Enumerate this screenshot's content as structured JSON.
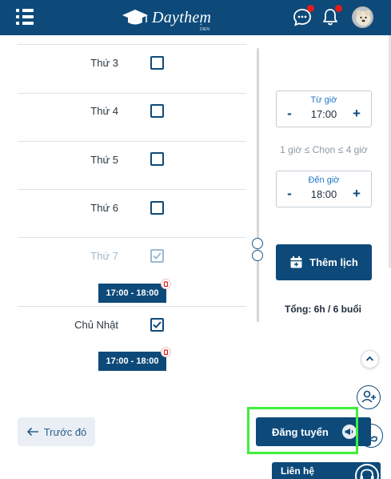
{
  "header": {
    "logo_text": "Daythem",
    "logo_sub": "+ DIEN"
  },
  "days": [
    {
      "label": "Thứ 3",
      "checked": false,
      "dim": false,
      "slot": ""
    },
    {
      "label": "Thứ 4",
      "checked": false,
      "dim": false,
      "slot": ""
    },
    {
      "label": "Thứ 5",
      "checked": false,
      "dim": false,
      "slot": ""
    },
    {
      "label": "Thứ 6",
      "checked": false,
      "dim": false,
      "slot": ""
    },
    {
      "label": "Thứ 7",
      "checked": true,
      "dim": true,
      "slot": "17:00 - 18:00"
    },
    {
      "label": "Chủ Nhật",
      "checked": true,
      "dim": false,
      "slot": "17:00 - 18:00"
    }
  ],
  "time": {
    "from_label": "Từ giờ",
    "from_value": "17:00",
    "hint": "1 giờ ≤ Chọn ≤ 4 giờ",
    "to_label": "Đến giờ",
    "to_value": "18:00",
    "minus": "-",
    "plus": "+"
  },
  "add_button": "Thêm lịch",
  "total": "Tổng: 6h / 6 buổi",
  "footer": {
    "prev_label": "Trước đó",
    "post_label": "Đăng tuyển",
    "contact_label": "Liên hệ"
  },
  "colors": {
    "primary": "#0d4a7a",
    "accent_blue": "#2277c5",
    "badge_red": "#e21c1c",
    "highlight_green": "#3ef03a"
  },
  "icons": [
    "menu-icon",
    "graduation-cap-icon",
    "chat-icon",
    "bell-icon",
    "calendar-add-icon",
    "trash-icon",
    "arrow-left-icon",
    "megaphone-icon",
    "chevron-up-icon",
    "add-user-icon",
    "phone-icon",
    "headset-icon"
  ]
}
